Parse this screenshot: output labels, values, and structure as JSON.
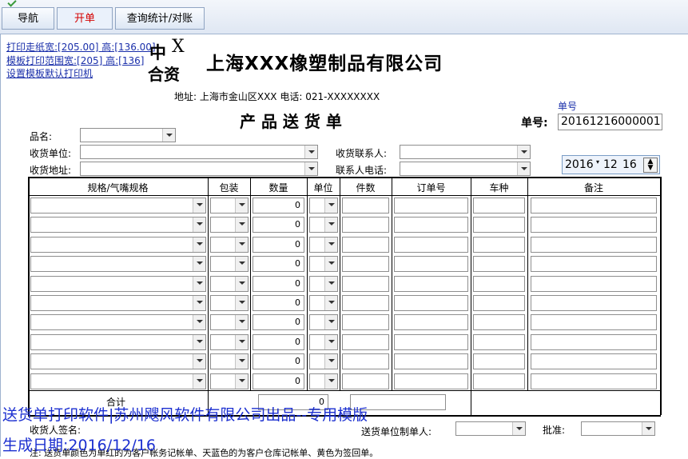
{
  "tabs": [
    {
      "label": "导航"
    },
    {
      "label": "开单"
    },
    {
      "label": "查询统计/对账"
    }
  ],
  "links": [
    "打印走纸宽:[205.00] 高:[136.00]",
    "模板打印范围宽:[205] 高:[136]",
    "设置模板默认打印机"
  ],
  "logo": {
    "top_left": "中",
    "top_right": "X",
    "bottom": "合资"
  },
  "company_name": "上海XXX橡塑制品有限公司",
  "address": "地址: 上海市金山区XXX 电话: 021-XXXXXXXX",
  "doc_title": "产 品 送 货 单",
  "order_no": {
    "caption": "单号",
    "label": "单号:",
    "value": "20161216000001"
  },
  "fields": {
    "product_name": "品名:",
    "receiver": "收货单位:",
    "address": "收货地址:",
    "contact": "收货联系人:",
    "contact_phone": "联系人电话:"
  },
  "date": {
    "year": "2016",
    "month": "12",
    "day": "16"
  },
  "columns": [
    "规格/气嘴规格",
    "包装",
    "数量",
    "单位",
    "件数",
    "订单号",
    "车种",
    "备注"
  ],
  "row_quantities": [
    "0",
    "0",
    "0",
    "0",
    "0",
    "0",
    "0",
    "0",
    "0",
    "0"
  ],
  "total": {
    "label": "合计",
    "value": "0"
  },
  "footer": {
    "sender_sign": "收货人签名:",
    "maker": "送货单位制单人:",
    "approve": "批准:",
    "note": "注: 送货单颜色为单红的为客户帐务记帐单、天蓝色的为客户仓库记帐单、黄色为签回单。"
  },
  "overlay": {
    "line1": "送货单打印软件|苏州飕风软件有限公司出品--专用模版",
    "line2": "生成日期:2016/12/16"
  }
}
